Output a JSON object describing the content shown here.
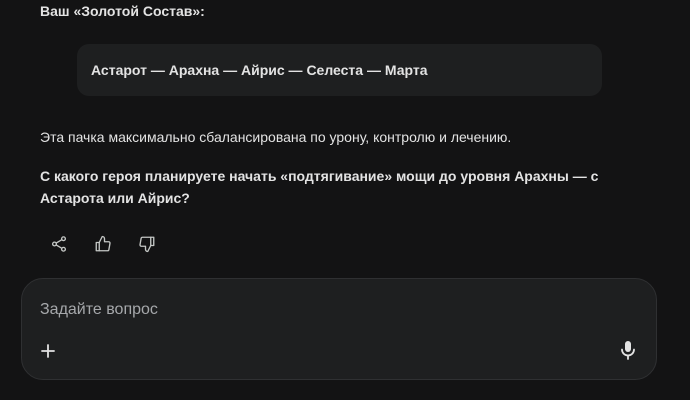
{
  "response": {
    "heading": "Ваш «Золотой Состав»:",
    "roster": "Астарот — Арахна — Айрис — Селеста — Марта",
    "summary": "Эта пачка максимально сбалансирована по урону, контролю и лечению.",
    "question": "С какого героя планируете начать «подтягивание» мощи до уровня Арахны — с Астарота или Айрис?"
  },
  "actions": {
    "icons": [
      "share-icon",
      "thumbs-up-icon",
      "thumbs-down-icon"
    ]
  },
  "composer": {
    "placeholder": "Задайте вопрос",
    "value": "",
    "add_icon": "plus-icon",
    "mic_icon": "microphone-icon"
  },
  "colors": {
    "background": "#131314",
    "surface": "#1e1f20",
    "text": "#e3e3e3",
    "placeholder": "#a6a8ab"
  }
}
